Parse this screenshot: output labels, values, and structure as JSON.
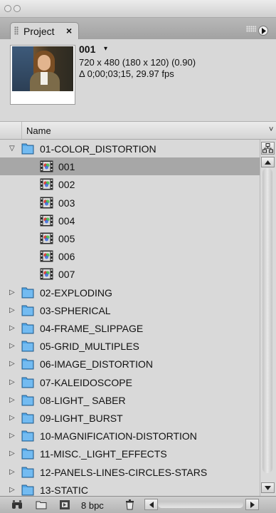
{
  "panel": {
    "tab_label": "Project",
    "close_glyph": "×"
  },
  "info": {
    "item_name": "001",
    "caret": "▾",
    "dimensions": "720 x 480  (180 x 120) (0.90)",
    "duration": "Δ 0;00;03;15, 29.97 fps"
  },
  "columns": {
    "name": "Name",
    "sort_glyph": "˅"
  },
  "tree": {
    "expanded_folder": "01-COLOR_DISTORTION",
    "comps": [
      "001",
      "002",
      "003",
      "004",
      "005",
      "006",
      "007"
    ],
    "collapsed_folders": [
      "02-EXPLODING",
      "03-SPHERICAL",
      "04-FRAME_SLIPPAGE",
      "05-GRID_MULTIPLES",
      "06-IMAGE_DISTORTION",
      "07-KALEIDOSCOPE",
      "08-LIGHT_ SABER",
      "09-LIGHT_BURST",
      "10-MAGNIFICATION-DISTORTION",
      "11-MISC._LIGHT_EFFECTS",
      "12-PANELS-LINES-CIRCLES-STARS",
      "13-STATIC"
    ],
    "selected_index": 0
  },
  "footer": {
    "bit_depth": "8 bpc"
  },
  "icons": {
    "disclosure_open": "▽",
    "disclosure_closed": "▷"
  },
  "colors": {
    "selection": "#a7a7a7",
    "folder_blue": "#4fa6e8"
  }
}
